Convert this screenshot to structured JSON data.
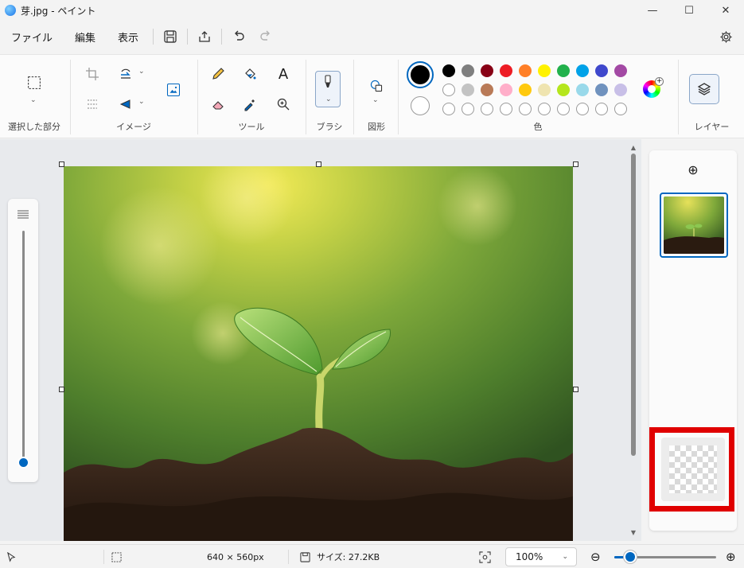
{
  "window": {
    "title": "芽.jpg - ペイント",
    "minimize_glyph": "—",
    "maximize_glyph": "☐",
    "close_glyph": "✕"
  },
  "menu": {
    "items": [
      "ファイル",
      "編集",
      "表示"
    ],
    "icons": [
      "save-icon",
      "share-icon",
      "undo-icon",
      "redo-icon",
      "settings-icon"
    ]
  },
  "ribbon": {
    "groups": {
      "selection": "選択した部分",
      "image": "イメージ",
      "tools": "ツール",
      "brush": "ブラシ",
      "shapes": "図形",
      "colors": "色",
      "layers": "レイヤー"
    },
    "text_tool_glyph": "A",
    "chevron_glyph": "⌄"
  },
  "colors": {
    "primary": "#000000",
    "secondary": "#ffffff",
    "row1": [
      "#000000",
      "#7f7f7f",
      "#880015",
      "#ed1c24",
      "#ff7f27",
      "#fff200",
      "#22b14c",
      "#00a2e8",
      "#3f48cc",
      "#a349a4"
    ],
    "row2": [
      "#ffffff",
      "#c3c3c3",
      "#b97a57",
      "#ffaec9",
      "#ffc90e",
      "#efe4b0",
      "#b5e61d",
      "#99d9ea",
      "#7092be",
      "#c8bfe7"
    ],
    "accent": "#0067c0",
    "highlight": "#e00000"
  },
  "canvas": {
    "image_name": "芽.jpg"
  },
  "layers": {
    "add_glyph": "⊕"
  },
  "status": {
    "dimensions": "640 × 560px",
    "size": "サイズ: 27.2KB",
    "zoom": "100%",
    "dropdown_glyph": "⌄",
    "zoom_out_glyph": "⊖",
    "zoom_in_glyph": "⊕"
  }
}
